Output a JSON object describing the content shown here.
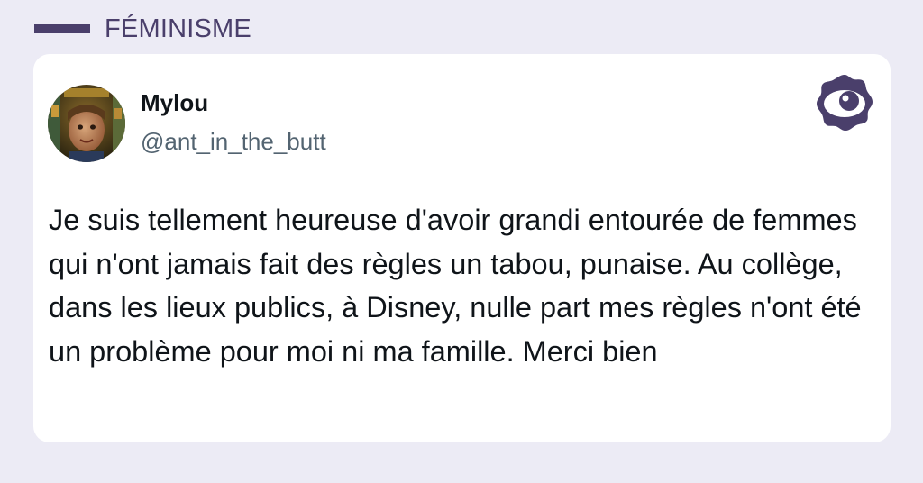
{
  "category": {
    "label": "FÉMINISME",
    "color": "#4a3f6b"
  },
  "tweet": {
    "author": {
      "name": "Mylou",
      "handle": "@ant_in_the_butt",
      "avatar": "profile-photo"
    },
    "text": "Je suis tellement heureuse d'avoir grandi entourée de femmes qui n'ont jamais fait des règles un tabou, punaise. Au collège, dans les lieux publics, à Disney, nulle part mes règles n'ont été un problème pour moi ni ma famille. Merci bien"
  },
  "brand": {
    "icon": "eye-logo-icon",
    "color": "#4a3f6b"
  },
  "colors": {
    "background": "#ecebf5",
    "card": "#ffffff",
    "text": "#0f1419",
    "handle": "#536471"
  }
}
